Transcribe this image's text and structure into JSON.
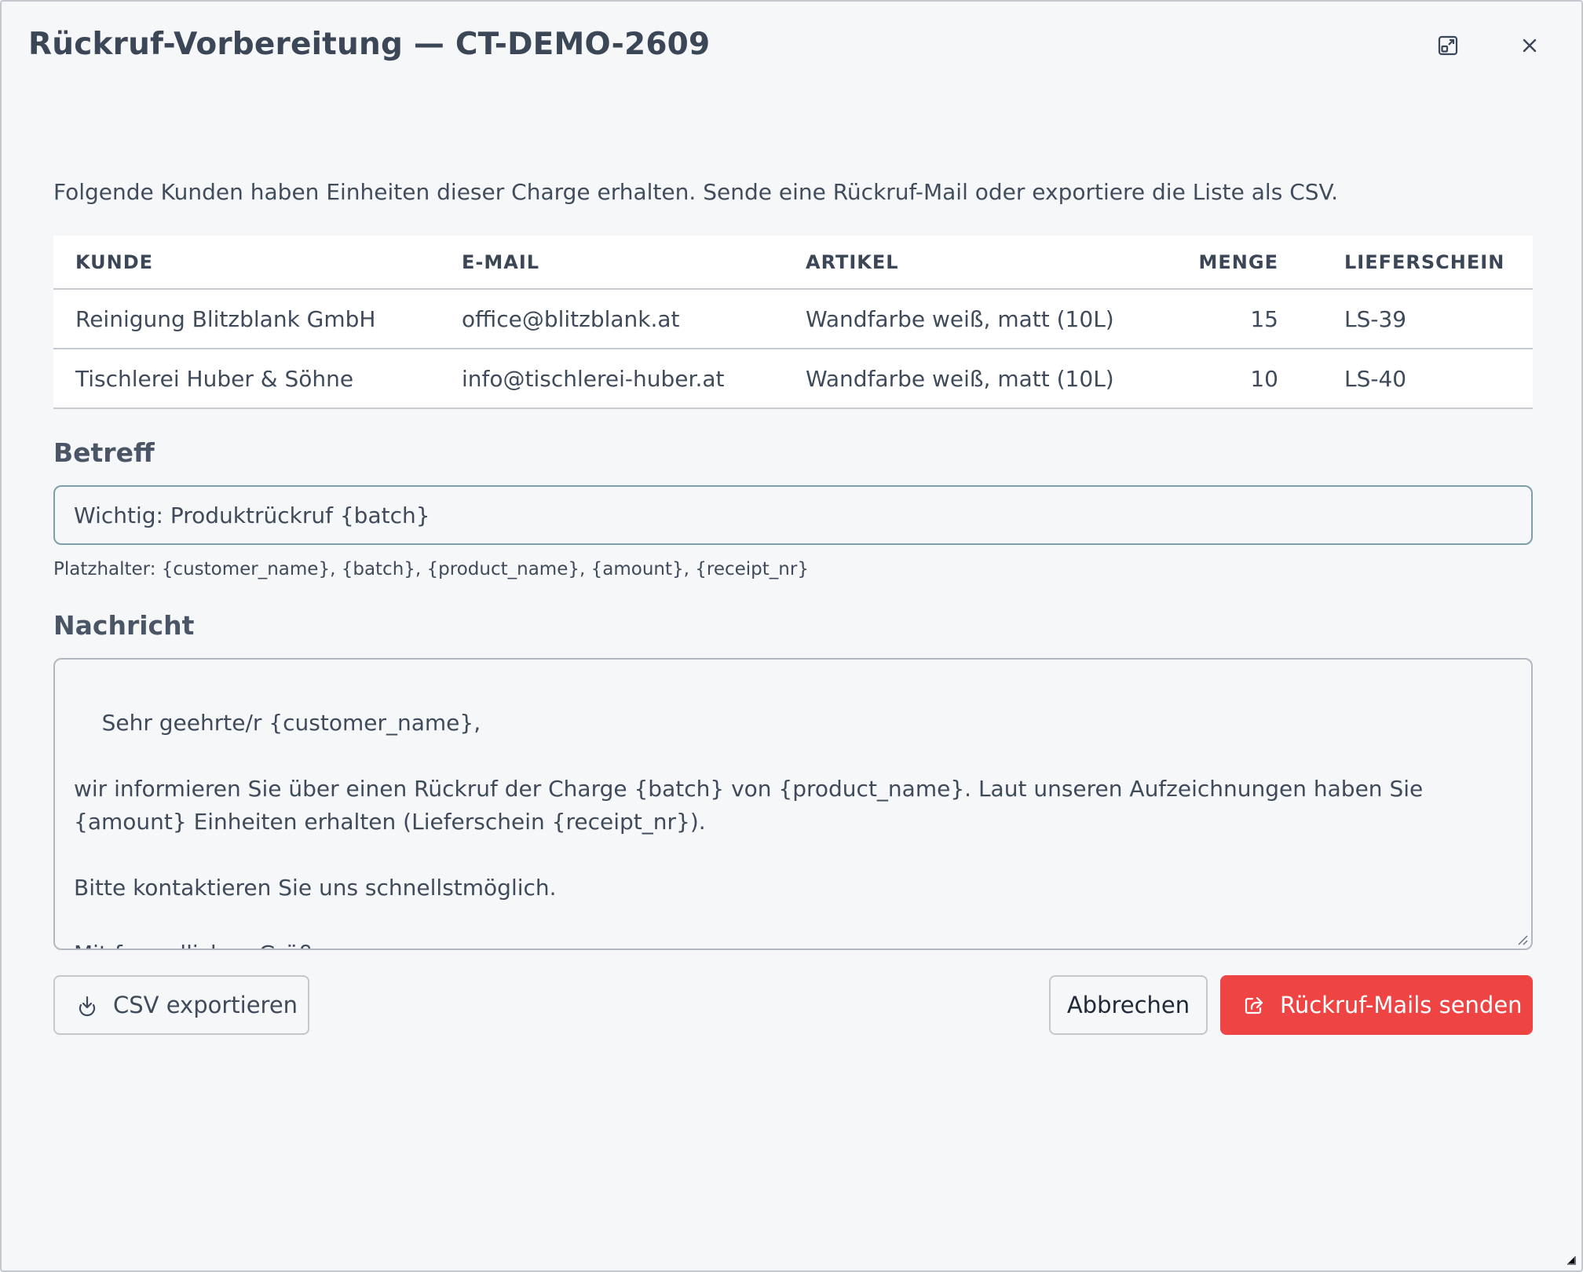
{
  "dialog": {
    "title": "Rückruf-Vorbereitung — CT-DEMO-2609",
    "icons": {
      "maximize": "expand-window-icon",
      "close": "close-icon"
    }
  },
  "intro": "Folgende Kunden haben Einheiten dieser Charge erhalten. Sende eine Rückruf-Mail oder exportiere die Liste als CSV.",
  "table": {
    "headers": {
      "customer": "KUNDE",
      "email": "E-MAIL",
      "article": "ARTIKEL",
      "amount": "MENGE",
      "receipt": "LIEFERSCHEIN"
    },
    "rows": [
      {
        "customer": "Reinigung Blitzblank GmbH",
        "email": "office@blitzblank.at",
        "article": "Wandfarbe weiß, matt (10L)",
        "amount": "15",
        "receipt": "LS-39"
      },
      {
        "customer": "Tischlerei Huber & Söhne",
        "email": "info@tischlerei-huber.at",
        "article": "Wandfarbe weiß, matt (10L)",
        "amount": "10",
        "receipt": "LS-40"
      }
    ]
  },
  "subject": {
    "label": "Betreff",
    "value": "Wichtig: Produktrückruf {batch}"
  },
  "placeholder_hint": "Platzhalter: {customer_name}, {batch}, {product_name}, {amount}, {receipt_nr}",
  "message": {
    "label": "Nachricht",
    "value": "Sehr geehrte/r {customer_name},\n\nwir informieren Sie über einen Rückruf der Charge {batch} von {product_name}. Laut unseren Aufzeichnungen haben Sie {amount} Einheiten erhalten (Lieferschein {receipt_nr}).\n\nBitte kontaktieren Sie uns schnellstmöglich.\n\nMit freundlichen Grüßen"
  },
  "buttons": {
    "export_csv": "CSV exportieren",
    "cancel": "Abbrechen",
    "send": "Rückruf-Mails senden"
  },
  "colors": {
    "background": "#f5f7f9",
    "danger": "#ef4444",
    "text": "#3f4a5a"
  }
}
